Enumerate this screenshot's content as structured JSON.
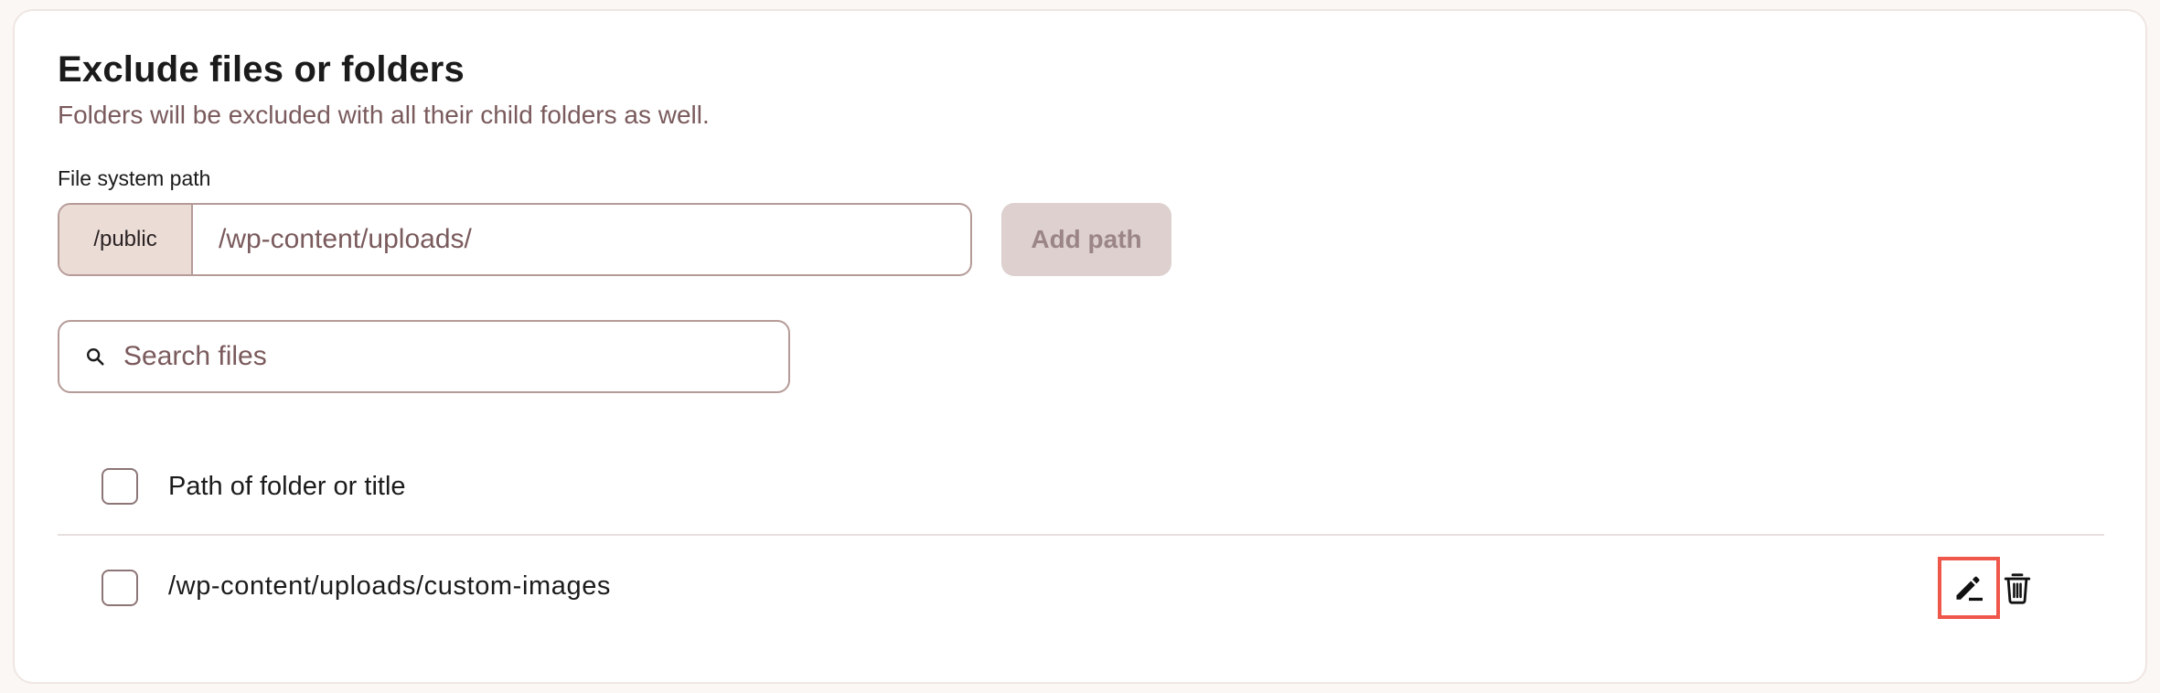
{
  "section": {
    "title": "Exclude files or folders",
    "subtitle": "Folders will be excluded with all their child folders as well."
  },
  "path_field": {
    "label": "File system path",
    "prefix": "/public",
    "placeholder": "/wp-content/uploads/",
    "value": "",
    "add_button_label": "Add path"
  },
  "search": {
    "placeholder": "Search files",
    "value": "",
    "icon": "search-icon"
  },
  "table": {
    "header_label": "Path of folder or title",
    "rows": [
      {
        "path": "/wp-content/uploads/custom-images",
        "checked": false,
        "actions": [
          "edit-icon",
          "trash-icon"
        ]
      }
    ]
  },
  "colors": {
    "accent_text": "#7a5a5c",
    "prefix_bg": "#ebdcd6",
    "disabled_button_bg": "#ddd0cf",
    "highlight_outline": "#f0574b"
  }
}
